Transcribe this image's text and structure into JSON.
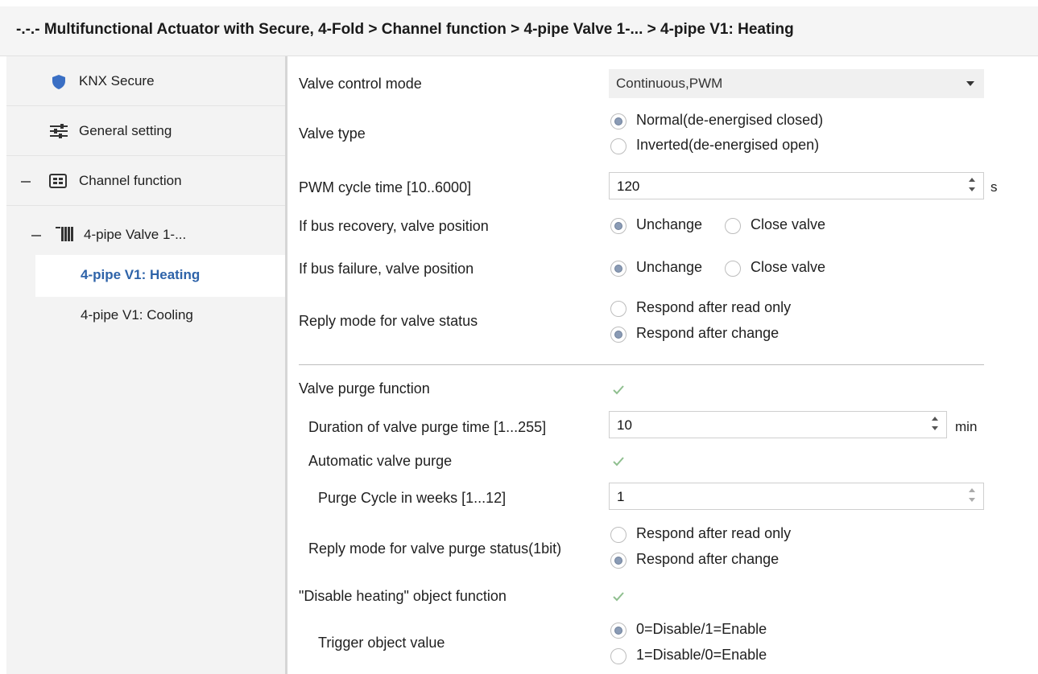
{
  "breadcrumb": "-.-.- Multifunctional Actuator with Secure, 4-Fold > Channel function > 4-pipe Valve 1-... > 4-pipe V1: Heating",
  "colors": {
    "accent": "#2e63a9",
    "shield": "#3a6fc4"
  },
  "sidebar": {
    "items": [
      {
        "label": "KNX Secure",
        "icon": "shield-icon"
      },
      {
        "label": "General setting",
        "icon": "sliders-icon"
      },
      {
        "label": "Channel function",
        "icon": "grid-icon"
      },
      {
        "label": "4-pipe Valve 1-...",
        "icon": "radiator-icon"
      },
      {
        "label": "4-pipe V1: Heating",
        "active": true
      },
      {
        "label": "4-pipe V1: Cooling"
      }
    ]
  },
  "params": {
    "valve_control_mode": {
      "label": "Valve control mode",
      "value": "Continuous,PWM"
    },
    "valve_type": {
      "label": "Valve type",
      "options": [
        "Normal(de-energised closed)",
        "Inverted(de-energised open)"
      ],
      "selected": 0
    },
    "pwm_cycle": {
      "label": "PWM cycle time [10..6000]",
      "value": "120",
      "unit": "s"
    },
    "bus_recovery": {
      "label": "If bus recovery, valve position",
      "options": [
        "Unchange",
        "Close valve"
      ],
      "selected": 0
    },
    "bus_failure": {
      "label": "If bus failure, valve position",
      "options": [
        "Unchange",
        "Close valve"
      ],
      "selected": 0
    },
    "reply_mode": {
      "label": "Reply mode for valve status",
      "options": [
        "Respond after read only",
        "Respond after change"
      ],
      "selected": 1
    },
    "purge_function": {
      "label": "Valve purge function",
      "checked": true
    },
    "purge_duration": {
      "label": "Duration of valve purge time [1...255]",
      "value": "10",
      "unit": "min"
    },
    "auto_purge": {
      "label": "Automatic valve purge",
      "checked": true
    },
    "purge_cycle": {
      "label": "Purge Cycle in weeks [1...12]",
      "value": "1"
    },
    "purge_reply": {
      "label": "Reply mode for valve purge status(1bit)",
      "options": [
        "Respond after read only",
        "Respond after change"
      ],
      "selected": 1
    },
    "disable_heating": {
      "label": "\"Disable heating\" object function",
      "checked": true
    },
    "trigger_value": {
      "label": "Trigger object value",
      "options": [
        "0=Disable/1=Enable",
        "1=Disable/0=Enable"
      ],
      "selected": 0
    }
  }
}
